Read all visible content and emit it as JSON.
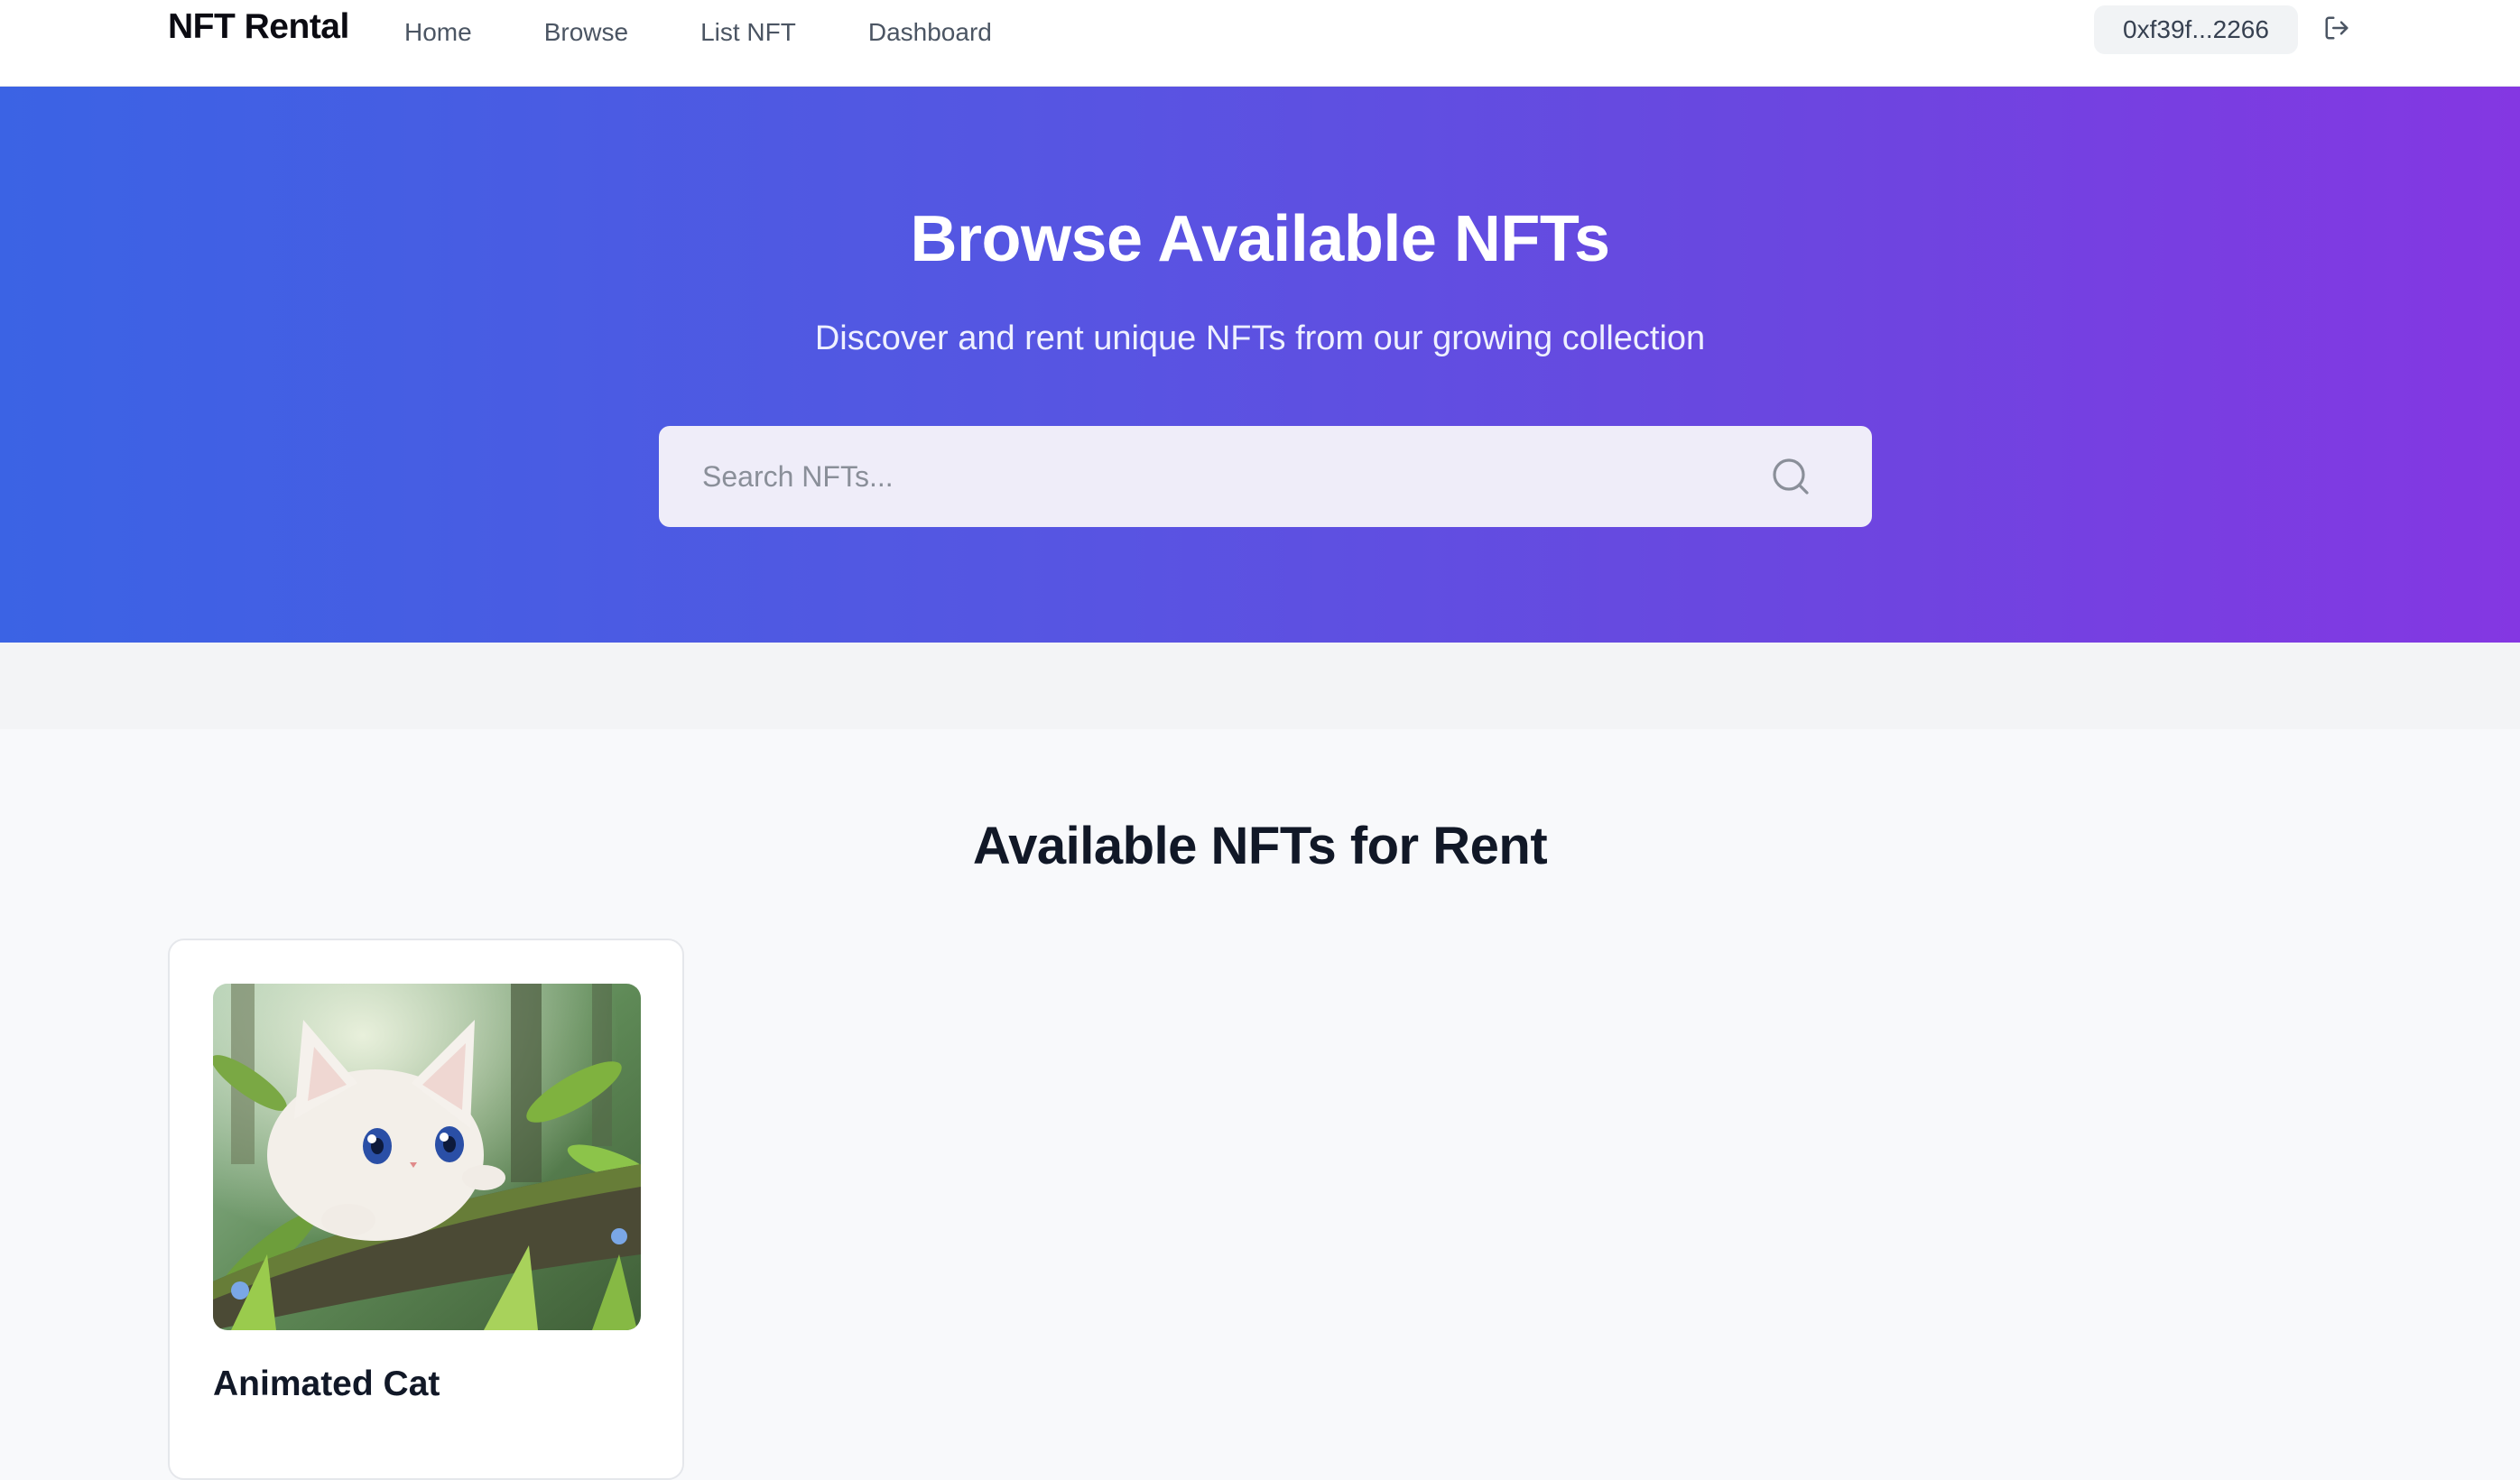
{
  "nav": {
    "brand": "NFT Rental",
    "links": [
      {
        "label": "Home"
      },
      {
        "label": "Browse"
      },
      {
        "label": "List NFT"
      },
      {
        "label": "Dashboard"
      }
    ],
    "wallet_address": "0xf39f...2266",
    "logout_icon": "logout-icon"
  },
  "hero": {
    "title": "Browse Available NFTs",
    "subtitle": "Discover and rent unique NFTs from our growing collection",
    "search": {
      "placeholder": "Search NFTs...",
      "value": "",
      "icon": "search-icon"
    }
  },
  "section": {
    "title": "Available NFTs for Rent",
    "cards": [
      {
        "title": "Animated Cat",
        "image": "anime-white-kitten-in-forest"
      }
    ]
  },
  "colors": {
    "hero_gradient_start": "#3b63e4",
    "hero_gradient_end": "#8437e2",
    "page_background": "#f8f9fb",
    "text_primary": "#111827"
  }
}
